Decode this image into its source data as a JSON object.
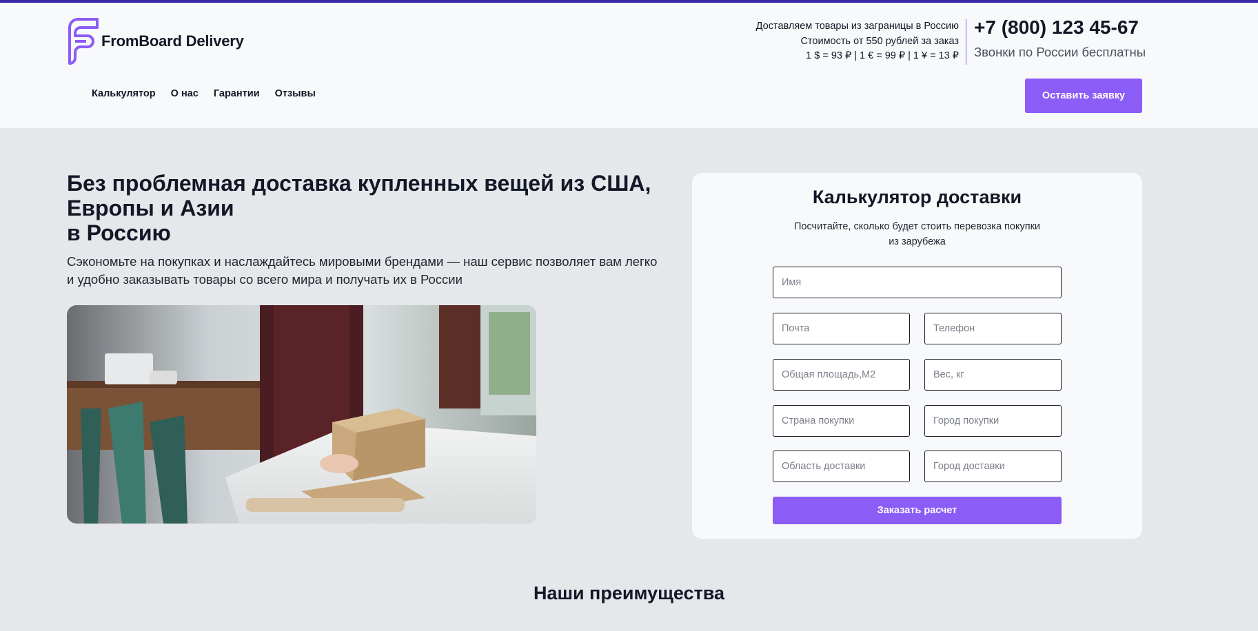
{
  "header": {
    "logo_text": "FromBoard Delivery",
    "info_lines": [
      "Доставляем товары из заграницы в Россию",
      "Стоимость от 550 рублей за заказ",
      "1 $ = 93 ₽ | 1 € = 99 ₽ | 1 ¥ = 13 ₽"
    ],
    "phone": "+7 (800) 123 45-67",
    "phone_note": "Звонки по России бесплатны",
    "nav": [
      "Калькулятор",
      "О нас",
      "Гарантии",
      "Отзывы"
    ],
    "cta_label": "Оставить заявку"
  },
  "hero": {
    "title_lines": [
      "Без проблемная доставка купленных вещей из США,",
      "Европы и Азии",
      "в Россию"
    ],
    "subtitle": "Сэкономьте на покупках и наслаждайтесь мировыми брендами — наш сервис позволяет вам легко и удобно заказывать товары со всего мира и получать их в России"
  },
  "calculator": {
    "title": "Калькулятор доставки",
    "description": "Посчитайте, сколько будет стоить перевозка покупки из зарубежа",
    "placeholders": {
      "name": "Имя",
      "email": "Почта",
      "phone": "Телефон",
      "area": "Общая площадь,М2",
      "weight": "Вес, кг",
      "purchase_country": "Страна покупки",
      "purchase_city": "Город покупки",
      "delivery_region": "Область доставки",
      "delivery_city": "Город доставки"
    },
    "submit_label": "Заказать расчет"
  },
  "advantages": {
    "title": "Наши преимущества"
  },
  "colors": {
    "accent": "#8b5cf6",
    "top_bar": "#3b2aa6",
    "page_bg": "#e6e7ea",
    "header_bg": "#f8f9fb"
  }
}
